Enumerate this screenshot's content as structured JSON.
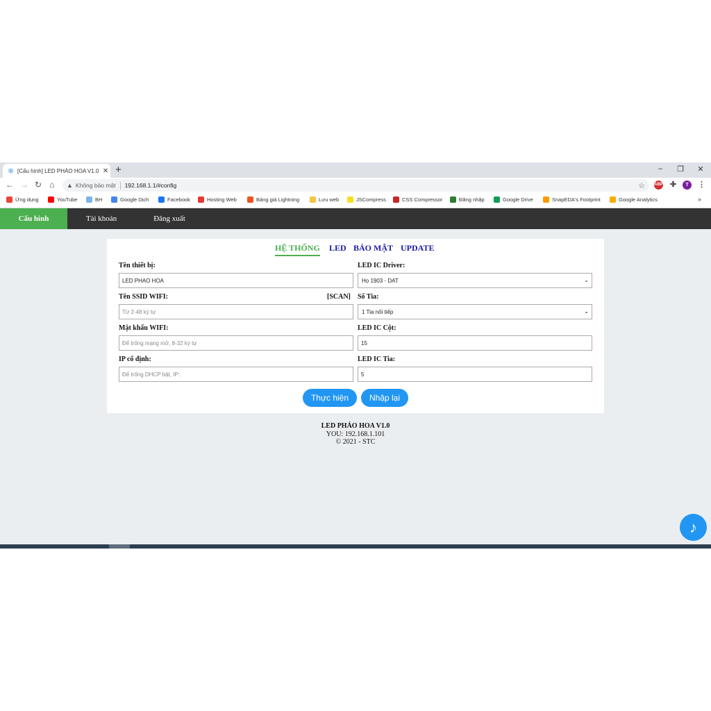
{
  "browser": {
    "tab_title": "[Cấu hình] LED PHÁO HOA V1.0",
    "insecure_label": "Không bảo mật",
    "url": "192.168.1.1/#config",
    "profile_initial": "T",
    "adblock_label": "ABP",
    "bookmarks": [
      {
        "label": "Ứng dụng",
        "color": "#e8453c"
      },
      {
        "label": "YouTube",
        "color": "#ff0000"
      },
      {
        "label": "BH",
        "color": "#7fb3e8"
      },
      {
        "label": "Google Dịch",
        "color": "#4285f4"
      },
      {
        "label": "Facebook",
        "color": "#1877f2"
      },
      {
        "label": "Hosting Web",
        "color": "#e53935"
      },
      {
        "label": "Bảng giá Lightning",
        "color": "#f4511e"
      },
      {
        "label": "Lưu web",
        "color": "#f6c342"
      },
      {
        "label": "JSCompress",
        "color": "#f7df1e"
      },
      {
        "label": "CSS Compressor",
        "color": "#c62828"
      },
      {
        "label": "Đăng nhập",
        "color": "#2e7d32"
      },
      {
        "label": "Google Drive",
        "color": "#0f9d58"
      },
      {
        "label": "SnapEDA's Footprint",
        "color": "#ff9800"
      },
      {
        "label": "Google Analytics",
        "color": "#f9ab00"
      }
    ]
  },
  "nav": {
    "config": "Cấu hình",
    "account": "Tài khoản",
    "logout": "Đăng xuất"
  },
  "tabs": {
    "system": "HỆ THỐNG",
    "led": "LED",
    "security": "BẢO MẬT",
    "update": "UPDATE"
  },
  "form": {
    "device_name_label": "Tên thiết bị:",
    "device_name_value": "LED PHAO HOA",
    "ssid_label": "Tên SSID WIFI:",
    "scan_label": "[SCAN]",
    "ssid_placeholder": "Từ 2-48 ký tự",
    "wifi_pass_label": "Mật khẩu WIFI:",
    "wifi_pass_placeholder": "Để trống mạng mở, 8-32 ký tự",
    "static_ip_label": "IP cố định:",
    "static_ip_placeholder": "Để trống DHCP bật, IP:",
    "driver_label": "LED IC Driver:",
    "driver_value": "Họ 1903 - DAT",
    "ray_count_label": "Số Tia:",
    "ray_count_value": "1 Tia nối tiếp",
    "ic_column_label": "LED IC Cột:",
    "ic_column_value": "15",
    "ic_ray_label": "LED IC Tia:",
    "ic_ray_value": "5",
    "submit_label": "Thực hiện",
    "reset_label": "Nhập lại"
  },
  "footer": {
    "product": "LED PHÁO HOA V1.0",
    "you": "YOU: 192.168.1.101",
    "copyright": "© 2021 - STC"
  }
}
